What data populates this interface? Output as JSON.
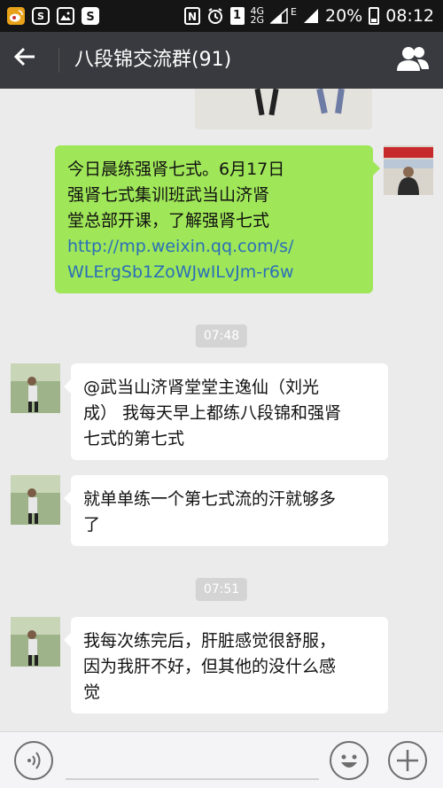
{
  "status_bar": {
    "network_type_top": "4G",
    "network_type_bottom": "2G",
    "signal_label": "E",
    "battery_percent": "20%",
    "time": "08:12",
    "sim_slot": "1",
    "icons": [
      "weibo-icon",
      "shield-s-icon",
      "photo-icon",
      "s-app-icon",
      "nfc-icon",
      "alarm-icon",
      "sim-icon",
      "signal-icon",
      "battery-icon"
    ]
  },
  "header": {
    "title": "八段锦交流群(91)",
    "back_icon": "back-arrow-icon",
    "members_icon": "group-members-icon"
  },
  "messages": [
    {
      "side": "right",
      "lines": [
        "今日晨练强肾七式。6月17日",
        "强肾七式集训班武当山济肾",
        "堂总部开课，了解强肾七式"
      ],
      "link_lines": [
        "http://mp.weixin.qq.com/s/",
        "WLErgSb1ZoWJwILvJm-r6w"
      ]
    },
    {
      "type": "time",
      "text": "07:48"
    },
    {
      "side": "left",
      "lines": [
        "@武当山济肾堂堂主逸仙（刘光",
        "成） 我每天早上都练八段锦和强肾",
        "七式的第七式"
      ]
    },
    {
      "side": "left",
      "lines": [
        "就单单练一个第七式流的汗就够多",
        "了"
      ]
    },
    {
      "type": "time",
      "text": "07:51"
    },
    {
      "side": "left",
      "lines": [
        "我每次练完后，肝脏感觉很舒服，",
        "因为我肝不好，但其他的没什么感",
        "觉"
      ]
    }
  ],
  "input_bar": {
    "voice_icon": "voice-input-icon",
    "emoji_icon": "emoji-icon",
    "plus_icon": "plus-icon"
  },
  "colors": {
    "nav": "#393a3f",
    "bubble_self": "#9fe658",
    "bubble_other": "#ffffff",
    "link": "#2a6fb8",
    "chat_bg": "#ebebeb"
  }
}
